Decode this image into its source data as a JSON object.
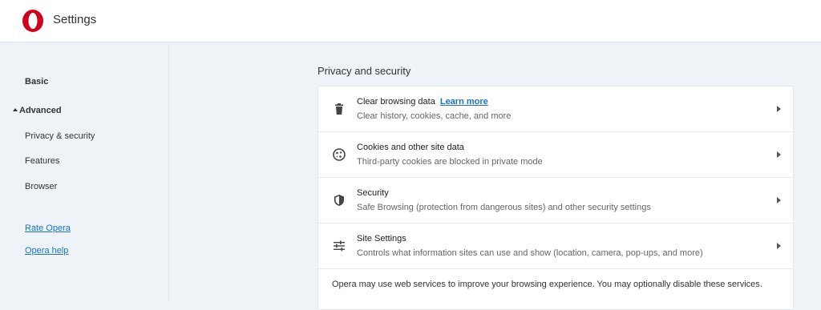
{
  "header": {
    "title": "Settings",
    "brand_color": "#d0021b"
  },
  "sidebar": {
    "basic": "Basic",
    "advanced": "Advanced",
    "items": [
      {
        "label": "Privacy & security"
      },
      {
        "label": "Features"
      },
      {
        "label": "Browser"
      }
    ],
    "links": [
      {
        "label": "Rate Opera"
      },
      {
        "label": "Opera help"
      }
    ]
  },
  "main": {
    "section_title": "Privacy and security",
    "rows": [
      {
        "title": "Clear browsing data",
        "link": "Learn more",
        "subtitle": "Clear history, cookies, cache, and more",
        "icon": "trash-icon"
      },
      {
        "title": "Cookies and other site data",
        "subtitle": "Third-party cookies are blocked in private mode",
        "icon": "cookie-icon"
      },
      {
        "title": "Security",
        "subtitle": "Safe Browsing (protection from dangerous sites) and other security settings",
        "icon": "shield-icon"
      },
      {
        "title": "Site Settings",
        "subtitle": "Controls what information sites can use and show (location, camera, pop-ups, and more)",
        "icon": "sliders-icon"
      }
    ],
    "footer": "Opera may use web services to improve your browsing experience. You may optionally disable these services."
  }
}
